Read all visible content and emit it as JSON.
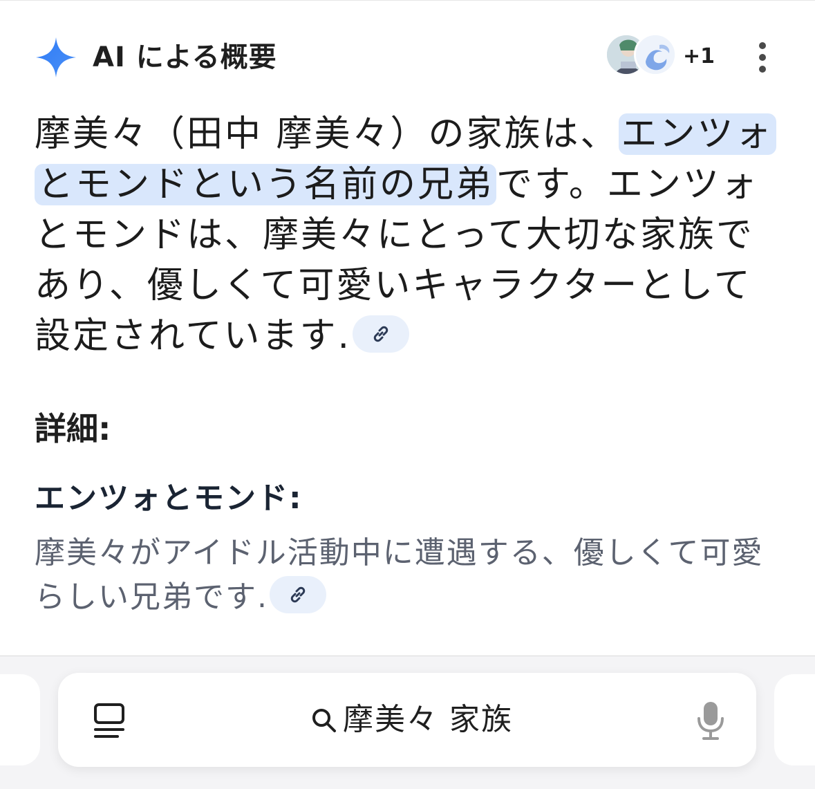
{
  "header": {
    "title": "AI による概要",
    "extra_sources_count": "+1",
    "icons": {
      "brand": "sparkle-icon",
      "more": "more-vertical-icon"
    }
  },
  "answer": {
    "before_highlight": "摩美々（田中 摩美々）の家族は、",
    "highlight": "エンツォとモンドという名前の兄弟",
    "after_highlight": "です。エンツォとモンドは、摩美々にとって大切な家族であり、優しくて可愛いキャラクターとして設定されています."
  },
  "details": {
    "heading": "詳細:",
    "subheading": "エンツォとモンド:",
    "text": "摩美々がアイドル活動中に遭遇する、優しくて可愛らしい兄弟です."
  },
  "search": {
    "query": "摩美々 家族"
  },
  "colors": {
    "accent": "#4285f4",
    "highlight_bg": "#d9e7fc",
    "chip_bg": "#e9f0fb",
    "secondary_text": "#5c6270"
  }
}
